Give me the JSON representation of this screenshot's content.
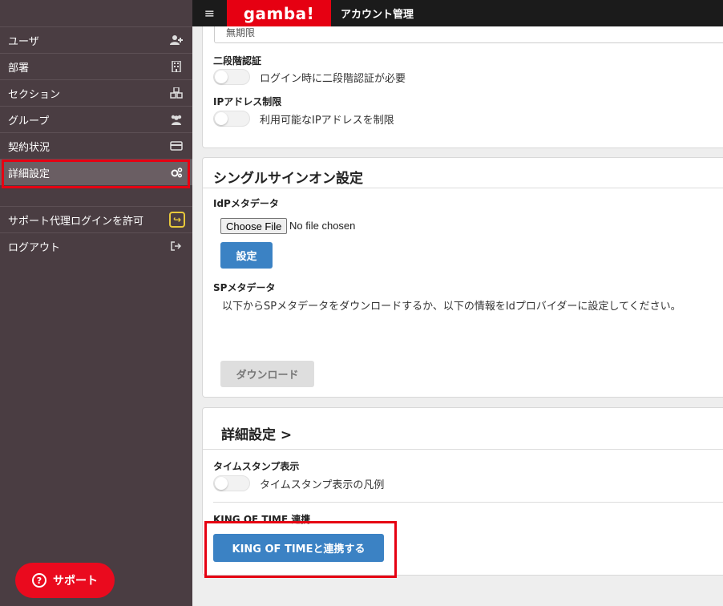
{
  "topbar": {
    "menu_icon": "hamburger-icon",
    "logo_text": "gamba!",
    "title": "アカウント管理"
  },
  "sidebar": {
    "items": [
      {
        "label": "ユーザ",
        "icon": "user-add-icon"
      },
      {
        "label": "部署",
        "icon": "building-icon"
      },
      {
        "label": "セクション",
        "icon": "cubes-icon"
      },
      {
        "label": "グループ",
        "icon": "users-icon"
      },
      {
        "label": "契約状況",
        "icon": "credit-card-icon"
      },
      {
        "label": "詳細設定",
        "icon": "gears-icon",
        "active": true
      }
    ],
    "support_login_label": "サポート代理ログインを許可",
    "support_login_icon": "share-icon",
    "logout_label": "ログアウト",
    "logout_icon": "sign-out-icon",
    "support_button_label": "サポート",
    "support_button_icon": "question-circle-icon"
  },
  "security_panel": {
    "cut_off_value": "無期限",
    "two_factor_label": "二段階認証",
    "two_factor_toggle_text": "ログイン時に二段階認証が必要",
    "ip_restriction_label": "IPアドレス制限",
    "ip_restriction_toggle_text": "利用可能なIPアドレスを制限"
  },
  "sso_panel": {
    "title": "シングルサインオン設定",
    "idp_label": "IdPメタデータ",
    "choose_file_label": "Choose File",
    "file_status": "No file chosen",
    "set_button": "設定",
    "sp_label": "SPメタデータ",
    "sp_description": "以下からSPメタデータをダウンロードするか、以下の情報をIdプロバイダーに設定してください。",
    "download_button": "ダウンロード"
  },
  "advanced_panel": {
    "title": "詳細設定 >",
    "timestamp_label": "タイムスタンプ表示",
    "timestamp_toggle_text": "タイムスタンプ表示の凡例",
    "kot_label": "KING OF TIME 連携",
    "kot_button": "KING OF TIMEと連携する"
  },
  "colors": {
    "sidebar_bg": "#4a3d42",
    "topbar_bg": "#1b1b1b",
    "brand_red": "#e60012",
    "primary_blue": "#3b82c4",
    "highlight_red": "#e60012"
  }
}
